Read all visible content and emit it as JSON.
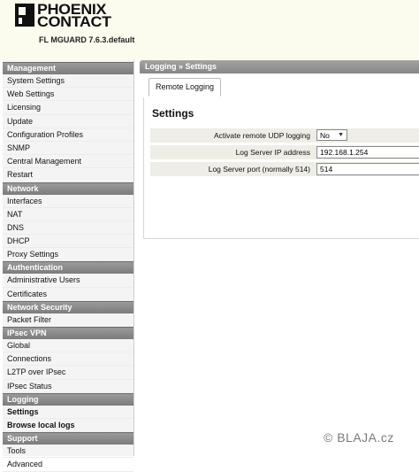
{
  "header": {
    "brand_line1": "PHOENIX",
    "brand_line2": "CONTACT",
    "version": "FL MGUARD 7.6.3.default"
  },
  "sidebar": {
    "sections": [
      {
        "title": "Management",
        "items": [
          "System Settings",
          "Web Settings",
          "Licensing",
          "Update",
          "Configuration Profiles",
          "SNMP",
          "Central Management",
          "Restart"
        ]
      },
      {
        "title": "Network",
        "items": [
          "Interfaces",
          "NAT",
          "DNS",
          "DHCP",
          "Proxy Settings"
        ]
      },
      {
        "title": "Authentication",
        "items": [
          "Administrative Users",
          "Certificates"
        ]
      },
      {
        "title": "Network Security",
        "items": [
          "Packet Filter"
        ]
      },
      {
        "title": "IPsec VPN",
        "items": [
          "Global",
          "Connections",
          "L2TP over IPsec",
          "IPsec Status"
        ]
      },
      {
        "title": "Logging",
        "items": [
          "Settings",
          "Browse local logs"
        ]
      },
      {
        "title": "Support",
        "items": [
          "Tools",
          "Advanced"
        ]
      }
    ]
  },
  "main": {
    "breadcrumb": "Logging » Settings",
    "tab_label": "Remote Logging",
    "panel_title": "Settings",
    "fields": {
      "udp_label": "Activate remote UDP logging",
      "udp_value": "No",
      "ip_label": "Log Server IP address",
      "ip_value": "192.168.1.254",
      "port_label": "Log Server port (normally 514)",
      "port_value": "514"
    }
  },
  "watermark": "© BLAJA.cz",
  "icons": {
    "logo_mark": "phoenix-contact-logo-icon",
    "dropdown": "chevron-down-icon"
  },
  "colors": {
    "header_bg": "#fbfbee",
    "section_header": "#8a8a8a",
    "field_row_bg": "#eeeee6"
  }
}
